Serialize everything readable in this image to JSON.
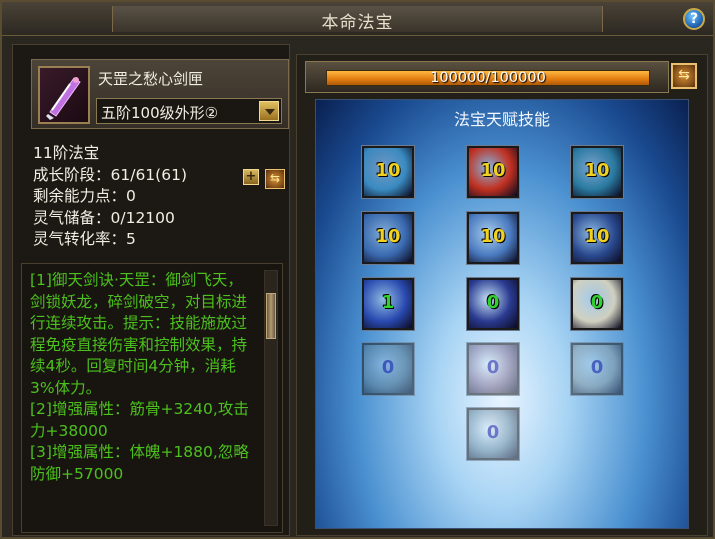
{
  "window": {
    "title": "本命法宝",
    "help_label": "?"
  },
  "item": {
    "name": "天罡之愁心剑匣",
    "form_label": "五阶100级外形②",
    "icon": "sword-case-icon"
  },
  "stats": {
    "rank": "11阶法宝",
    "growth": "成长阶段：61/61(61)",
    "remaining_points": "剩余能力点：0",
    "qi_storage": "灵气储备：0/12100",
    "qi_conversion": "灵气转化率：5"
  },
  "buttons": {
    "plus": "+",
    "swap": "⇆"
  },
  "description": [
    "[1]御天剑诀·天罡：御剑飞天，剑锁妖龙，碎剑破空，对目标进行连续攻击。提示：技能施放过程免疫直接伤害和控制效果，持续4秒。回复时间4分钟，消耗3%体力。",
    "[2]增强属性：筋骨+3240,攻击力+38000",
    "[3]增强属性：体魄+1880,忽略防御+57000"
  ],
  "experience": {
    "text": "100000/100000",
    "fraction": 1.0
  },
  "talent": {
    "title": "法宝天赋技能",
    "skills": [
      {
        "level": "10",
        "state": "max",
        "color": "#3a8ac0",
        "icon": "tower-icon"
      },
      {
        "level": "10",
        "state": "max",
        "color": "#c03020",
        "icon": "slash-icon"
      },
      {
        "level": "10",
        "state": "max",
        "color": "#2a7aa0",
        "icon": "fortress-icon"
      },
      {
        "level": "10",
        "state": "max",
        "color": "#3a6ab0",
        "icon": "wave-icon"
      },
      {
        "level": "10",
        "state": "max",
        "color": "#4a7ac0",
        "icon": "burst-icon"
      },
      {
        "level": "10",
        "state": "max",
        "color": "#2a4a90",
        "icon": "dive-icon"
      },
      {
        "level": "1",
        "state": "green",
        "color": "#2a4ab0",
        "icon": "spirit-icon"
      },
      {
        "level": "0",
        "state": "green",
        "color": "#2a3a90",
        "icon": "swirl-icon"
      },
      {
        "level": "0",
        "state": "green",
        "color": "#d0d0c0",
        "icon": "yin-yang-icon"
      },
      {
        "level": "0",
        "state": "locked",
        "color": "#5a7a90",
        "icon": "leaf-icon"
      },
      {
        "level": "0",
        "state": "locked",
        "color": "#7a6a90",
        "icon": "feather-icon"
      },
      {
        "level": "0",
        "state": "locked",
        "color": "#8a9aa0",
        "icon": "blade-icon"
      },
      {
        "level": "0",
        "state": "locked",
        "color": "#6a8aa0",
        "icon": "aura-icon"
      }
    ]
  }
}
